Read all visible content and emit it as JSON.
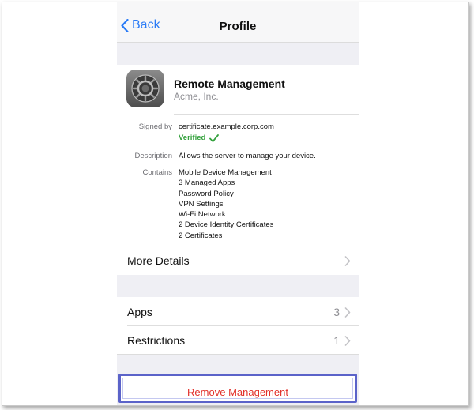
{
  "nav": {
    "back_label": "Back",
    "title": "Profile"
  },
  "profile": {
    "name": "Remote Management",
    "organization": "Acme, Inc.",
    "signed_by_label": "Signed by",
    "signed_by_value": "certificate.example.corp.com",
    "verified_label": "Verified",
    "description_label": "Description",
    "description_value": "Allows the server to manage your device.",
    "contains_label": "Contains",
    "contains_items": [
      "Mobile Device Management",
      "3 Managed Apps",
      "Password Policy",
      "VPN Settings",
      "Wi-Fi Network",
      "2 Device Identity Certificates",
      "2 Certificates"
    ],
    "more_details_label": "More Details"
  },
  "sections": {
    "apps_label": "Apps",
    "apps_count": "3",
    "restrictions_label": "Restrictions",
    "restrictions_count": "1"
  },
  "actions": {
    "remove_label": "Remove Management"
  },
  "colors": {
    "accent_blue": "#2a7bf6",
    "verified_green": "#34a13d",
    "destructive_red": "#e2302a",
    "highlight_border": "#5b63c9"
  },
  "icons": {
    "back": "chevron-left-icon",
    "app": "settings-gear-icon",
    "verified": "checkmark-icon",
    "disclosure": "chevron-right-icon"
  }
}
